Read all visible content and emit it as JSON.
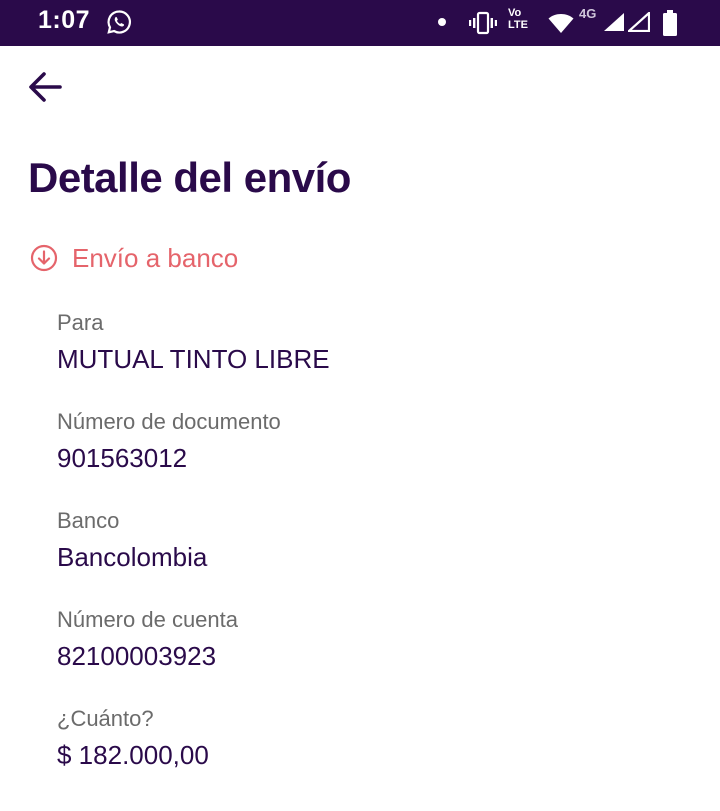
{
  "status_bar": {
    "time": "1:07",
    "network_label": "4G",
    "volte_top": "Vo",
    "volte_bottom": "LTE",
    "background_color": "#2a0a4a",
    "icons": [
      "whatsapp-icon",
      "notification-dot-icon",
      "vibrate-icon",
      "volte-icon",
      "wifi-icon",
      "signal-icon",
      "signal-icon",
      "battery-icon"
    ]
  },
  "header": {
    "back_icon": "arrow-left-icon",
    "title": "Detalle del envío"
  },
  "transfer": {
    "type_icon": "arrow-down-circle-icon",
    "type_label": "Envío a banco",
    "type_color": "#e5646b"
  },
  "details": {
    "recipient": {
      "label": "Para",
      "value": "MUTUAL TINTO LIBRE"
    },
    "document": {
      "label": "Número de documento",
      "value": "901563012"
    },
    "bank": {
      "label": "Banco",
      "value": "Bancolombia"
    },
    "account": {
      "label": "Número de cuenta",
      "value": "82100003923"
    },
    "amount": {
      "label": "¿Cuánto?",
      "value": "$ 182.000,00"
    }
  },
  "colors": {
    "primary": "#2a0a4a",
    "label_gray": "#6b6b6b"
  }
}
